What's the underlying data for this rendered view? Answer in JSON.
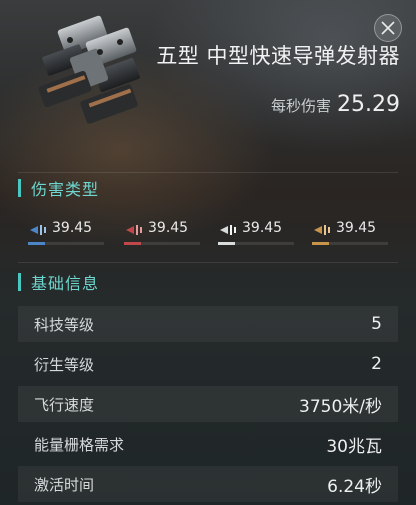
{
  "module": {
    "title": "五型 中型快速导弹发射器",
    "dps_label": "每秒伤害",
    "dps_value": "25.29"
  },
  "close_icon": "close-icon",
  "damage_section": {
    "title": "伤害类型",
    "types": [
      {
        "icon": "em-damage-icon",
        "value": "39.45",
        "color": "#4a86c8",
        "fill_fraction": 0.22
      },
      {
        "icon": "thermal-damage-icon",
        "value": "39.45",
        "color": "#c0474a",
        "fill_fraction": 0.22
      },
      {
        "icon": "kinetic-damage-icon",
        "value": "39.45",
        "color": "#d8dcdd",
        "fill_fraction": 0.22
      },
      {
        "icon": "explosive-damage-icon",
        "value": "39.45",
        "color": "#c8944a",
        "fill_fraction": 0.22
      }
    ]
  },
  "info_section": {
    "title": "基础信息",
    "rows": [
      {
        "label": "科技等级",
        "value": "5"
      },
      {
        "label": "衍生等级",
        "value": "2"
      },
      {
        "label": "飞行速度",
        "value": "3750米/秒"
      },
      {
        "label": "能量栅格需求",
        "value": "30兆瓦"
      },
      {
        "label": "激活时间",
        "value": "6.24秒"
      }
    ]
  },
  "colors": {
    "accent": "#48c8c0",
    "section_title": "#6ed6cf"
  }
}
